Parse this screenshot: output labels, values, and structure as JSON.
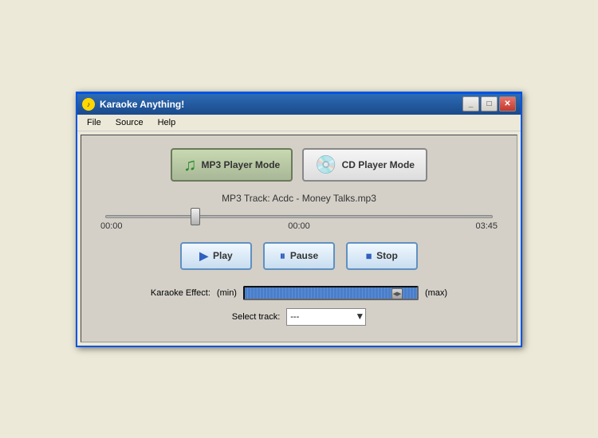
{
  "window": {
    "title": "Karaoke Anything!",
    "icon": "♪"
  },
  "titlebar": {
    "minimize_label": "_",
    "maximize_label": "□",
    "close_label": "✕"
  },
  "menu": {
    "items": [
      "File",
      "Source",
      "Help"
    ]
  },
  "mode_buttons": {
    "mp3": {
      "label": "MP3 Player Mode",
      "icon": "♫"
    },
    "cd": {
      "label": "CD Player Mode",
      "icon": "💿"
    }
  },
  "track": {
    "name": "MP3 Track: Acdc  -  Money Talks.mp3"
  },
  "times": {
    "current": "00:00",
    "middle": "00:00",
    "total": "03:45"
  },
  "transport": {
    "play_label": "Play",
    "pause_label": "Pause",
    "stop_label": "Stop"
  },
  "karaoke": {
    "label": "Karaoke Effect:",
    "min_label": "(min)",
    "max_label": "(max)"
  },
  "track_select": {
    "label": "Select track:",
    "placeholder": "---",
    "options": [
      "---"
    ]
  }
}
